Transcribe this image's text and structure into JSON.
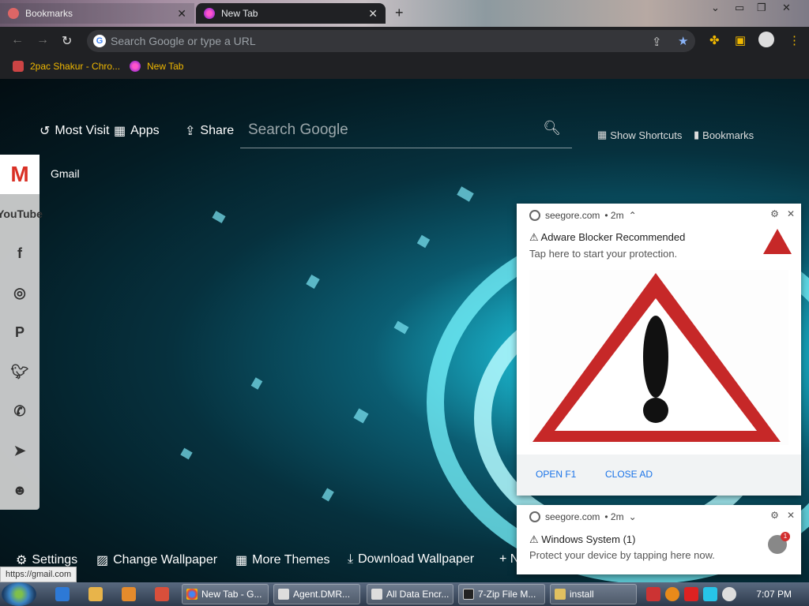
{
  "tabs": [
    {
      "label": "Bookmarks",
      "active": false
    },
    {
      "label": "New Tab",
      "active": true
    }
  ],
  "omnibox": {
    "placeholder": "Search Google or type a URL"
  },
  "bookmarks": [
    {
      "label": "2pac Shakur - Chro..."
    },
    {
      "label": "New Tab"
    }
  ],
  "topnav": {
    "most_visited": "Most Visit",
    "apps": "Apps",
    "share": "Share",
    "search_placeholder": "Search Google",
    "show_shortcuts": "Show Shortcuts",
    "bookmarks": "Bookmarks"
  },
  "sidebar": {
    "gmail_tooltip": "Gmail",
    "items": [
      "gmail",
      "youtube",
      "facebook",
      "instagram",
      "pinterest",
      "twitter",
      "whatsapp",
      "telegram",
      "reddit"
    ],
    "youtube_text": "YouTube"
  },
  "bottom": {
    "settings": "Settings",
    "change_wallpaper": "Change Wallpaper",
    "more_themes": "More Themes",
    "download_wallpaper": "Download Wallpaper",
    "more": "+ N"
  },
  "notification1": {
    "source": "seegore.com",
    "time": "• 2m",
    "title": "⚠ Adware Blocker Recommended",
    "body": "Tap here to start your protection.",
    "action1": "OPEN F1",
    "action2": "CLOSE AD"
  },
  "notification2": {
    "source": "seegore.com",
    "time": "• 2m",
    "title": "⚠ Windows System (1)",
    "body": "Protect your device by tapping here now.",
    "badge": "1"
  },
  "status_url": "https://gmail.com",
  "taskbar": {
    "tasks": [
      "New Tab - G...",
      "Agent.DMR...",
      "All Data Encr...",
      "7-Zip File M...",
      "install"
    ],
    "clock": "7:07 PM"
  },
  "colors": {
    "accent_blue": "#1a73e8",
    "warning_red": "#c62828",
    "bookmark_text": "#f0b800"
  }
}
